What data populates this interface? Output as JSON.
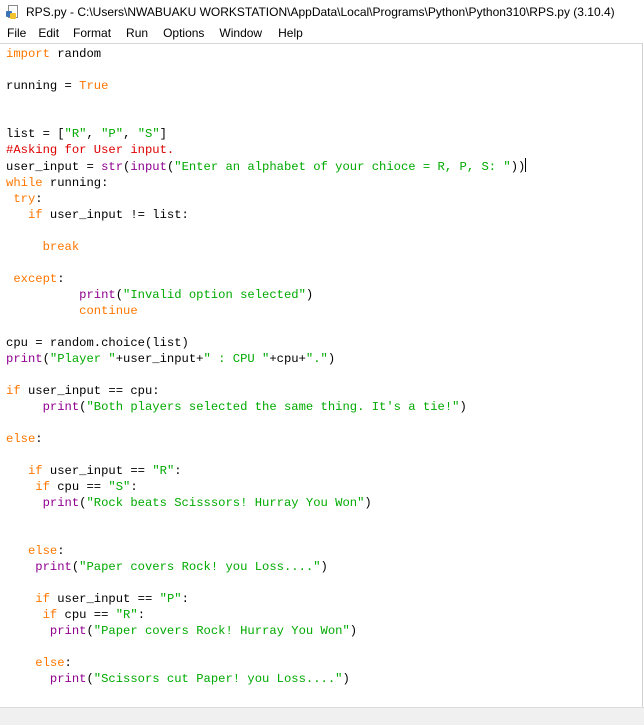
{
  "window": {
    "title": "RPS.py - C:\\Users\\NWABUAKU WORKSTATION\\AppData\\Local\\Programs\\Python\\Python310\\RPS.py (3.10.4)",
    "icon": "python-file-icon"
  },
  "menu": {
    "items": [
      "File",
      "Edit",
      "Format",
      "Run",
      "Options",
      "Window",
      "Help"
    ]
  },
  "colors": {
    "keyword": "#ff7700",
    "builtin": "#900090",
    "string": "#00aa00",
    "comment": "#dd0000",
    "text": "#000000"
  },
  "editor": {
    "lines": [
      [
        {
          "t": "kw",
          "v": "import"
        },
        {
          "t": "n",
          "v": " random"
        }
      ],
      [],
      [
        {
          "t": "n",
          "v": "running = "
        },
        {
          "t": "kw",
          "v": "True"
        }
      ],
      [],
      [],
      [
        {
          "t": "n",
          "v": "list = ["
        },
        {
          "t": "st",
          "v": "\"R\""
        },
        {
          "t": "n",
          "v": ", "
        },
        {
          "t": "st",
          "v": "\"P\""
        },
        {
          "t": "n",
          "v": ", "
        },
        {
          "t": "st",
          "v": "\"S\""
        },
        {
          "t": "n",
          "v": "]"
        }
      ],
      [
        {
          "t": "cm",
          "v": "#Asking for User input."
        }
      ],
      [
        {
          "t": "n",
          "v": "user_input = "
        },
        {
          "t": "bi",
          "v": "str"
        },
        {
          "t": "n",
          "v": "("
        },
        {
          "t": "bi",
          "v": "input"
        },
        {
          "t": "n",
          "v": "("
        },
        {
          "t": "st",
          "v": "\"Enter an alphabet of your chioce = R, P, S: \""
        },
        {
          "t": "n",
          "v": "))"
        },
        {
          "t": "cursor",
          "v": ""
        }
      ],
      [
        {
          "t": "kw",
          "v": "while"
        },
        {
          "t": "n",
          "v": " running:"
        }
      ],
      [
        {
          "t": "n",
          "v": " "
        },
        {
          "t": "kw",
          "v": "try"
        },
        {
          "t": "n",
          "v": ":"
        }
      ],
      [
        {
          "t": "n",
          "v": "   "
        },
        {
          "t": "kw",
          "v": "if"
        },
        {
          "t": "n",
          "v": " user_input != list:"
        }
      ],
      [],
      [
        {
          "t": "n",
          "v": "     "
        },
        {
          "t": "kw",
          "v": "break"
        }
      ],
      [],
      [
        {
          "t": "n",
          "v": " "
        },
        {
          "t": "kw",
          "v": "except"
        },
        {
          "t": "n",
          "v": ":"
        }
      ],
      [
        {
          "t": "n",
          "v": "          "
        },
        {
          "t": "bi",
          "v": "print"
        },
        {
          "t": "n",
          "v": "("
        },
        {
          "t": "st",
          "v": "\"Invalid option selected\""
        },
        {
          "t": "n",
          "v": ")"
        }
      ],
      [
        {
          "t": "n",
          "v": "          "
        },
        {
          "t": "kw",
          "v": "continue"
        }
      ],
      [],
      [
        {
          "t": "n",
          "v": "cpu = random.choice(list)"
        }
      ],
      [
        {
          "t": "bi",
          "v": "print"
        },
        {
          "t": "n",
          "v": "("
        },
        {
          "t": "st",
          "v": "\"Player \""
        },
        {
          "t": "n",
          "v": "+user_input+"
        },
        {
          "t": "st",
          "v": "\" : CPU \""
        },
        {
          "t": "n",
          "v": "+cpu+"
        },
        {
          "t": "st",
          "v": "\".\""
        },
        {
          "t": "n",
          "v": ")"
        }
      ],
      [],
      [
        {
          "t": "kw",
          "v": "if"
        },
        {
          "t": "n",
          "v": " user_input == cpu:"
        }
      ],
      [
        {
          "t": "n",
          "v": "     "
        },
        {
          "t": "bi",
          "v": "print"
        },
        {
          "t": "n",
          "v": "("
        },
        {
          "t": "st",
          "v": "\"Both players selected the same thing. It's a tie!\""
        },
        {
          "t": "n",
          "v": ")"
        }
      ],
      [],
      [
        {
          "t": "kw",
          "v": "else"
        },
        {
          "t": "n",
          "v": ":"
        }
      ],
      [],
      [
        {
          "t": "n",
          "v": "   "
        },
        {
          "t": "kw",
          "v": "if"
        },
        {
          "t": "n",
          "v": " user_input == "
        },
        {
          "t": "st",
          "v": "\"R\""
        },
        {
          "t": "n",
          "v": ":"
        }
      ],
      [
        {
          "t": "n",
          "v": "    "
        },
        {
          "t": "kw",
          "v": "if"
        },
        {
          "t": "n",
          "v": " cpu == "
        },
        {
          "t": "st",
          "v": "\"S\""
        },
        {
          "t": "n",
          "v": ":"
        }
      ],
      [
        {
          "t": "n",
          "v": "     "
        },
        {
          "t": "bi",
          "v": "print"
        },
        {
          "t": "n",
          "v": "("
        },
        {
          "t": "st",
          "v": "\"Rock beats Scisssors! Hurray You Won\""
        },
        {
          "t": "n",
          "v": ")"
        }
      ],
      [],
      [],
      [
        {
          "t": "n",
          "v": "   "
        },
        {
          "t": "kw",
          "v": "else"
        },
        {
          "t": "n",
          "v": ":"
        }
      ],
      [
        {
          "t": "n",
          "v": "    "
        },
        {
          "t": "bi",
          "v": "print"
        },
        {
          "t": "n",
          "v": "("
        },
        {
          "t": "st",
          "v": "\"Paper covers Rock! you Loss....\""
        },
        {
          "t": "n",
          "v": ")"
        }
      ],
      [],
      [
        {
          "t": "n",
          "v": "    "
        },
        {
          "t": "kw",
          "v": "if"
        },
        {
          "t": "n",
          "v": " user_input == "
        },
        {
          "t": "st",
          "v": "\"P\""
        },
        {
          "t": "n",
          "v": ":"
        }
      ],
      [
        {
          "t": "n",
          "v": "     "
        },
        {
          "t": "kw",
          "v": "if"
        },
        {
          "t": "n",
          "v": " cpu == "
        },
        {
          "t": "st",
          "v": "\"R\""
        },
        {
          "t": "n",
          "v": ":"
        }
      ],
      [
        {
          "t": "n",
          "v": "      "
        },
        {
          "t": "bi",
          "v": "print"
        },
        {
          "t": "n",
          "v": "("
        },
        {
          "t": "st",
          "v": "\"Paper covers Rock! Hurray You Won\""
        },
        {
          "t": "n",
          "v": ")"
        }
      ],
      [],
      [
        {
          "t": "n",
          "v": "    "
        },
        {
          "t": "kw",
          "v": "else"
        },
        {
          "t": "n",
          "v": ":"
        }
      ],
      [
        {
          "t": "n",
          "v": "      "
        },
        {
          "t": "bi",
          "v": "print"
        },
        {
          "t": "n",
          "v": "("
        },
        {
          "t": "st",
          "v": "\"Scissors cut Paper! you Loss....\""
        },
        {
          "t": "n",
          "v": ")"
        }
      ]
    ]
  }
}
